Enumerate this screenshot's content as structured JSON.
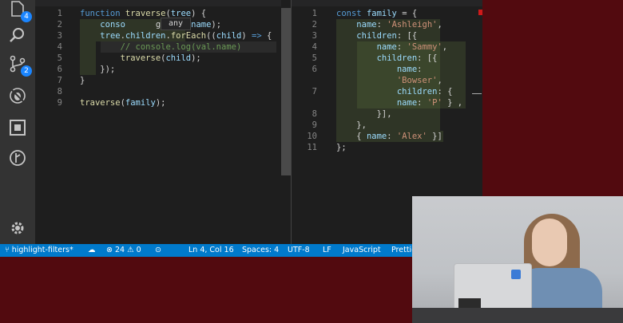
{
  "activity_bar": {
    "explorer_badge": "4",
    "scm_badge": "2"
  },
  "left_editor": {
    "hover_text": "any",
    "lines": [
      {
        "n": "1",
        "t": [
          [
            "k",
            "function "
          ],
          [
            "f",
            "traverse"
          ],
          [
            "p",
            "("
          ],
          [
            "v",
            "tree"
          ],
          [
            "p",
            ") {"
          ]
        ]
      },
      {
        "n": "2",
        "t": [
          [
            "p",
            "    "
          ],
          [
            "v",
            "conso"
          ],
          [
            "p",
            "      "
          ],
          [
            "p",
            "g("
          ],
          [
            "v",
            "tree"
          ],
          [
            "p",
            "."
          ],
          [
            "v",
            "name"
          ],
          [
            "p",
            ");"
          ]
        ]
      },
      {
        "n": "3",
        "t": [
          [
            "p",
            "    "
          ],
          [
            "v",
            "tree"
          ],
          [
            "p",
            "."
          ],
          [
            "v",
            "children"
          ],
          [
            "p",
            "."
          ],
          [
            "f",
            "forEach"
          ],
          [
            "p",
            "(("
          ],
          [
            "v",
            "child"
          ],
          [
            "p",
            ")"
          ],
          [
            "k",
            " => "
          ],
          [
            "p",
            "{"
          ]
        ]
      },
      {
        "n": "4",
        "t": [
          [
            "p",
            "        "
          ],
          [
            "c",
            "// console.log(val.name)"
          ]
        ]
      },
      {
        "n": "5",
        "t": [
          [
            "p",
            "        "
          ],
          [
            "f",
            "traverse"
          ],
          [
            "p",
            "("
          ],
          [
            "v",
            "child"
          ],
          [
            "p",
            ");"
          ]
        ]
      },
      {
        "n": "6",
        "t": [
          [
            "p",
            "    });"
          ]
        ]
      },
      {
        "n": "7",
        "t": [
          [
            "p",
            "}"
          ]
        ]
      },
      {
        "n": "8",
        "t": []
      },
      {
        "n": "9",
        "t": [
          [
            "f",
            "traverse"
          ],
          [
            "p",
            "("
          ],
          [
            "v",
            "family"
          ],
          [
            "p",
            ");"
          ]
        ]
      }
    ]
  },
  "right_editor": {
    "lines": [
      {
        "n": "1",
        "t": [
          [
            "k",
            "const "
          ],
          [
            "v",
            "family"
          ],
          [
            "p",
            " = {"
          ]
        ]
      },
      {
        "n": "2",
        "t": [
          [
            "p",
            "    "
          ],
          [
            "v",
            "name"
          ],
          [
            "p",
            ": "
          ],
          [
            "s",
            "'Ashleigh'"
          ],
          [
            "p",
            ","
          ]
        ]
      },
      {
        "n": "3",
        "t": [
          [
            "p",
            "    "
          ],
          [
            "v",
            "children"
          ],
          [
            "p",
            ": [{"
          ]
        ]
      },
      {
        "n": "4",
        "t": [
          [
            "p",
            "        "
          ],
          [
            "v",
            "name"
          ],
          [
            "p",
            ": "
          ],
          [
            "s",
            "'Sammy'"
          ],
          [
            "p",
            ","
          ]
        ]
      },
      {
        "n": "5",
        "t": [
          [
            "p",
            "        "
          ],
          [
            "v",
            "children"
          ],
          [
            "p",
            ": [{"
          ]
        ]
      },
      {
        "n": "6",
        "t": [
          [
            "p",
            "            "
          ],
          [
            "v",
            "name"
          ],
          [
            "p",
            ":"
          ]
        ]
      },
      {
        "n": "",
        "t": [
          [
            "p",
            "            "
          ],
          [
            "s",
            "'Bowser'"
          ],
          [
            "p",
            ","
          ]
        ]
      },
      {
        "n": "7",
        "t": [
          [
            "p",
            "            "
          ],
          [
            "v",
            "children"
          ],
          [
            "p",
            ": {"
          ]
        ]
      },
      {
        "n": "",
        "t": [
          [
            "p",
            "            "
          ],
          [
            "v",
            "name"
          ],
          [
            "p",
            ": "
          ],
          [
            "s",
            "'P'"
          ],
          [
            "p",
            " } ,"
          ]
        ]
      },
      {
        "n": "8",
        "t": [
          [
            "p",
            "        }],"
          ]
        ]
      },
      {
        "n": "9",
        "t": [
          [
            "p",
            "    },"
          ]
        ]
      },
      {
        "n": "10",
        "t": [
          [
            "p",
            "    { "
          ],
          [
            "v",
            "name"
          ],
          [
            "p",
            ": "
          ],
          [
            "s",
            "'Alex'"
          ],
          [
            "p",
            " }]"
          ]
        ]
      },
      {
        "n": "11",
        "t": [
          [
            "p",
            "};"
          ]
        ]
      }
    ]
  },
  "status_bar": {
    "branch": "highlight-filters*",
    "errors": "24",
    "warnings": "0",
    "position": "Ln 4, Col 16",
    "spaces": "Spaces: 4",
    "encoding": "UTF-8",
    "eol": "LF",
    "language": "JavaScript",
    "formatter": "Prettier: ✓"
  }
}
